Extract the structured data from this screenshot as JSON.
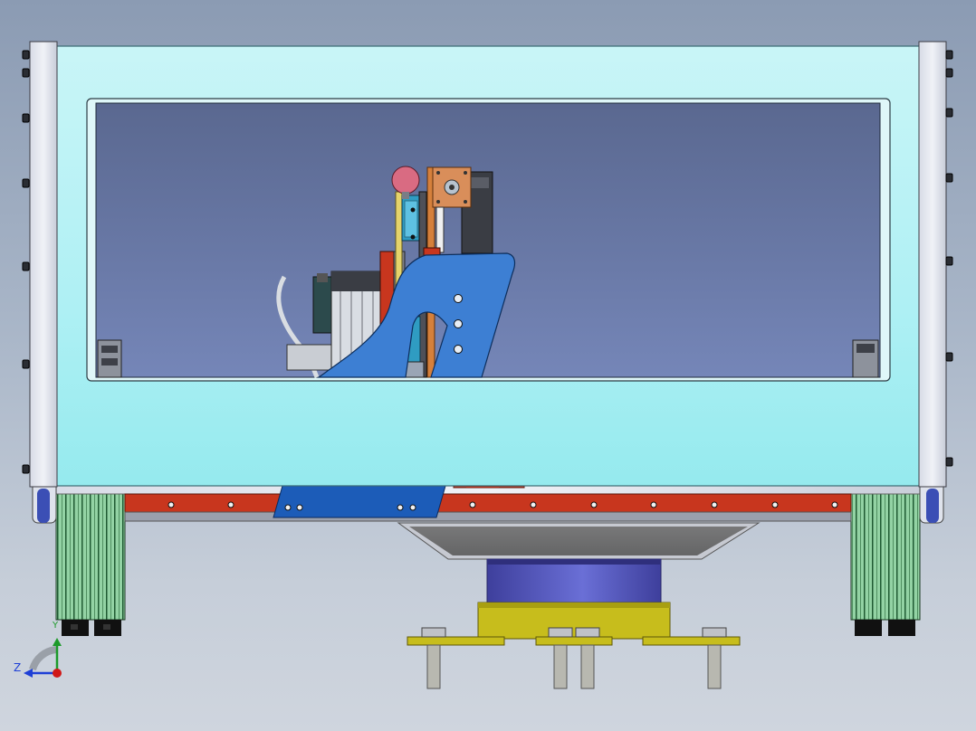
{
  "viewport": {
    "background_top": "#8b9bb3",
    "background_bottom": "#cfd5de"
  },
  "colors": {
    "enclosure_cover": "#aef0f4",
    "window_glass": "#6577a6",
    "blue_bracket": "#3d7fd3",
    "red_rail": "#c8361e",
    "green_extrusion": "#93d3a4",
    "purple_cylinder": "#5a5fc4",
    "yellow_base": "#c7bd1c",
    "pink_knob": "#d96b82"
  },
  "view_triad": {
    "axes": [
      {
        "label": "Z",
        "color": "#1e3fd6",
        "icon": "arrow-left-icon"
      },
      {
        "label": "Y",
        "color": "#1d9a2a",
        "icon": "arrow-up-icon"
      }
    ],
    "origin_icon": "red-dot-icon"
  }
}
